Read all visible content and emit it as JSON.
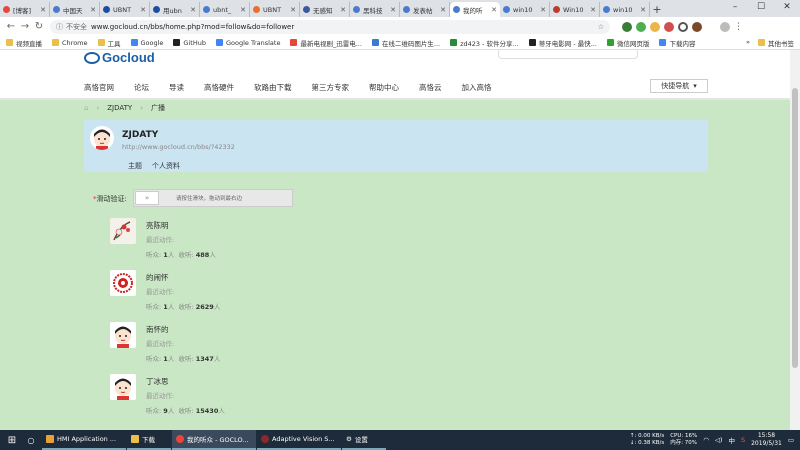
{
  "browser": {
    "tabs": [
      {
        "title": "[博客]",
        "color": "#e8453c"
      },
      {
        "title": "中国天",
        "color": "#4a7bd0"
      },
      {
        "title": "UBNT",
        "color": "#1a4fa0"
      },
      {
        "title": "用ubn",
        "color": "#1a4fa0"
      },
      {
        "title": "ubnt_",
        "color": "#4a7bd0"
      },
      {
        "title": "UBNT",
        "color": "#e8702a"
      },
      {
        "title": "无感知",
        "color": "#3a5a9a"
      },
      {
        "title": "黑科技",
        "color": "#4a7bd0"
      },
      {
        "title": "发表帖",
        "color": "#4a7bd0"
      },
      {
        "title": "我的听",
        "color": "#4a7bd0",
        "active": true
      },
      {
        "title": "win10",
        "color": "#4a7bd0"
      },
      {
        "title": "Win10",
        "color": "#c0392b"
      },
      {
        "title": "win10",
        "color": "#4a7bd0"
      }
    ],
    "new_tab": "+",
    "window_controls": [
      "–",
      "☐",
      "✕"
    ],
    "not_secure": "不安全",
    "url": "www.gocloud.cn/bbs/home.php?mod=follow&do=follower",
    "bookmarks": [
      "视频直播",
      "Chrome",
      "工具",
      "Google",
      "GitHub",
      "Google Translate",
      "最新电视剧_迅雷电...",
      "在线二维码图片生...",
      "zd423 - 软件分享...",
      "蒂牙电影网 - 最快...",
      "微信网页版",
      "下载内容"
    ],
    "bookmarks_more": "»",
    "other_bookmarks": "其他书签"
  },
  "site": {
    "logo": "Gocloud",
    "nav": [
      "高恪官网",
      "论坛",
      "导读",
      "高恪硬件",
      "软路由下载",
      "第三方专家",
      "帮助中心",
      "高恪云",
      "加入高恪"
    ],
    "quick_nav": "快捷导航",
    "breadcrumb": [
      "ZJDATY",
      "广播"
    ]
  },
  "profile": {
    "name": "ZJDATY",
    "url": "http://www.gocloud.cn/bbs/?42332",
    "tabs": [
      "主题",
      "个人资料"
    ]
  },
  "captcha": {
    "label": "滑动验证:",
    "required": "*",
    "handle": "»",
    "hint": "请按住滑块，拖动到最右边"
  },
  "followers": [
    {
      "name": "亮陈明",
      "activity": "最近动作:",
      "listen_label": "听众:",
      "listen": "1",
      "listen_unit": "人",
      "hear_label": "收听:",
      "hear": "488",
      "hear_unit": "人"
    },
    {
      "name": "的闹怀",
      "activity": "最近动作:",
      "listen_label": "听众:",
      "listen": "1",
      "listen_unit": "人",
      "hear_label": "收听:",
      "hear": "2629",
      "hear_unit": "人"
    },
    {
      "name": "南怀的",
      "activity": "最近动作:",
      "listen_label": "听众:",
      "listen": "1",
      "listen_unit": "人",
      "hear_label": "收听:",
      "hear": "1347",
      "hear_unit": "人"
    },
    {
      "name": "丁冰思",
      "activity": "最近动作:",
      "listen_label": "听众:",
      "listen": "9",
      "listen_unit": "人",
      "hear_label": "收听:",
      "hear": "15430",
      "hear_unit": "人"
    }
  ],
  "taskbar": {
    "apps": [
      "HMI Application ...",
      "下载",
      "我的听众 - GOCLO...",
      "Adaptive Vision S...",
      "设置"
    ],
    "net_up": "↑: 0.00 KB/s",
    "net_down": "↓: 0.38 KB/s",
    "cpu": "CPU: 16%",
    "mem": "内存: 70%",
    "ime": "中",
    "time": "15:58",
    "date": "2019/5/31"
  }
}
